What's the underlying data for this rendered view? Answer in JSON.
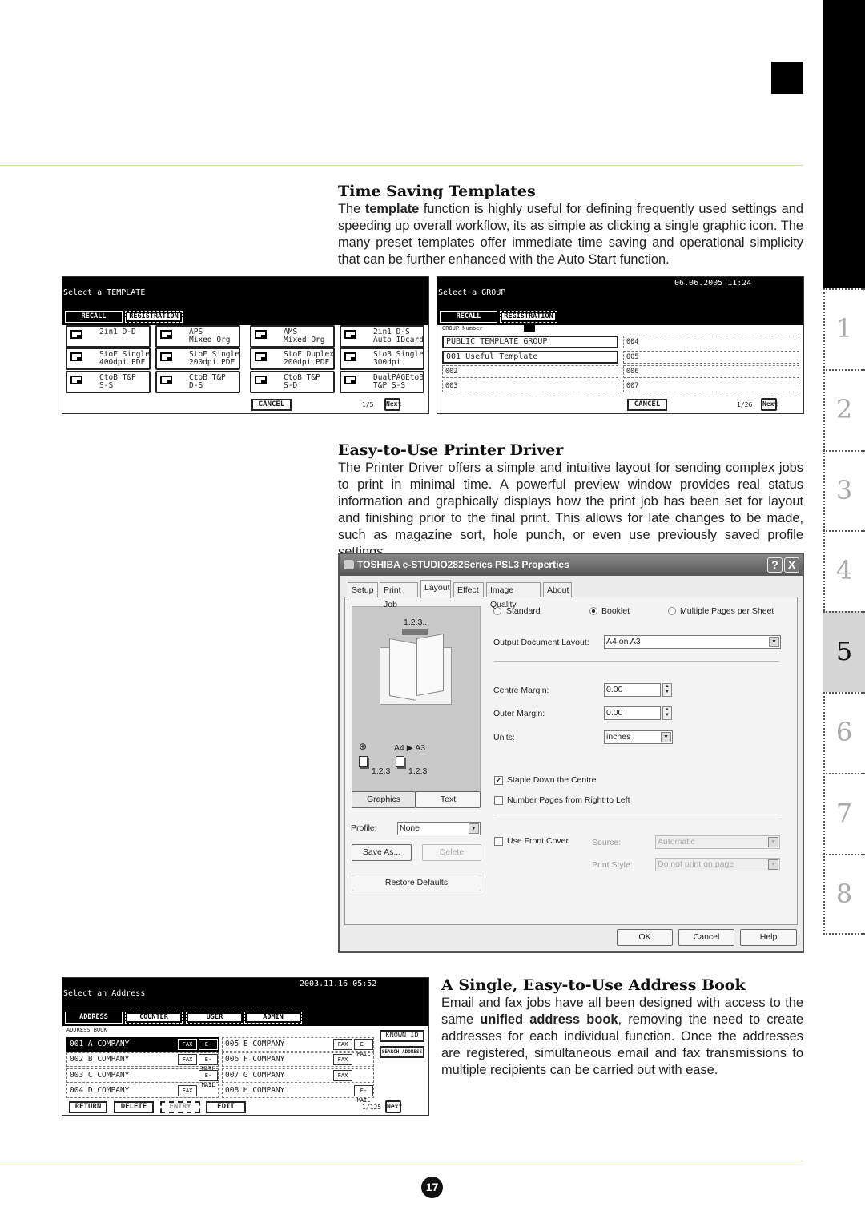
{
  "sidebar": {
    "tabs": [
      "1",
      "2",
      "3",
      "4",
      "5",
      "6",
      "7",
      "8"
    ],
    "active": "5"
  },
  "sections": {
    "templates": {
      "heading": "Time Saving Templates",
      "body_pre": "The ",
      "body_bold": "template",
      "body_post": " function is highly useful for defining frequently used settings and speeding up overall workflow, its as simple as clicking a single graphic icon. The many preset templates offer immediate time saving and operational simplicity that can be further enhanced with the Auto Start function."
    },
    "printer": {
      "heading": "Easy-to-Use Printer Driver",
      "body": "The Printer Driver offers a simple and intuitive layout for sending complex jobs to print in minimal time. A powerful preview window provides real status information and graphically displays how the print job has been set for layout and finishing prior to the final print. This allows for late changes to be made, such as magazine sort, hole punch, or even use previously saved profile settings."
    },
    "address": {
      "heading": "A Single, Easy-to-Use Address Book",
      "body_pre": "Email and fax jobs have all been designed with access to the same ",
      "body_bold": "unified address book",
      "body_post": ", removing the need to create addresses for each individual function. Once the addresses are registered, simultaneous email and fax transmissions to multiple recipients can be carried out with ease."
    }
  },
  "template_panel": {
    "title": "Select a TEMPLATE",
    "tabs": [
      "RECALL",
      "REGISTRATION"
    ],
    "buttons": [
      "2in1 D-D",
      "APS\nMixed Org",
      "AMS\nMixed Org",
      "2in1 D-S\nAuto IDcard",
      "StoF Single\n400dpi PDF",
      "StoF Single\n200dpi PDF",
      "StoF Duplex\n200dpi PDF",
      "StoB Single\n300dpi",
      "CtoB T&P\nS-S",
      "CtoB T&P\nD-S",
      "CtoB T&P\nS-D",
      "DualPAGEtoB\nT&P S-S"
    ],
    "cancel": "CANCEL",
    "page": "1/5",
    "next": "Next"
  },
  "group_panel": {
    "title": "Select a GROUP",
    "datetime": "06.06.2005 11:24",
    "tabs": [
      "RECALL",
      "REGISTRATION"
    ],
    "group_number_label": "GROUP Number",
    "left": [
      "PUBLIC TEMPLATE GROUP",
      "001 Useful Template",
      "002",
      "003"
    ],
    "right": [
      "004",
      "005",
      "006",
      "007"
    ],
    "cancel": "CANCEL",
    "page": "1/26",
    "next": "Next"
  },
  "printer_dialog": {
    "title": "TOSHIBA e-STUDIO282Series PSL3 Properties",
    "help_btn": "?",
    "close_btn": "X",
    "tabs": [
      "Setup",
      "Print Job",
      "Layout",
      "Effect",
      "Image Quality",
      "About"
    ],
    "active_tab": "Layout",
    "preview": {
      "seq": "1.2.3...",
      "size_from": "A4",
      "size_to": "A3",
      "stack1": "1.2.3",
      "stack2": "1.2.3"
    },
    "view_buttons": [
      "Graphics",
      "Text"
    ],
    "profile_label": "Profile:",
    "profile_value": "None",
    "save_as": "Save As...",
    "delete": "Delete",
    "restore": "Restore Defaults",
    "layout_options": [
      "Standard",
      "Booklet",
      "Multiple Pages per Sheet"
    ],
    "selected_layout": "Booklet",
    "output_label": "Output Document Layout:",
    "output_value": "A4 on A3",
    "centre_label": "Centre Margin:",
    "centre_value": "0.00",
    "outer_label": "Outer Margin:",
    "outer_value": "0.00",
    "units_label": "Units:",
    "units_value": "inches",
    "staple_label": "Staple Down the Centre",
    "staple_checked": true,
    "rtl_label": "Number Pages from Right to Left",
    "rtl_checked": false,
    "front_cover_label": "Use Front Cover",
    "front_cover_checked": false,
    "source_label": "Source:",
    "source_value": "Automatic",
    "print_style_label": "Print Style:",
    "print_style_value": "Do not print on page",
    "ok": "OK",
    "cancel": "Cancel",
    "help": "Help"
  },
  "address_panel": {
    "title": "Select an Address",
    "datetime": "2003.11.16 05:52",
    "tabs": [
      "ADDRESS",
      "COUNTER",
      "USER",
      "ADMIN"
    ],
    "book_label": "ADDRESS BOOK",
    "entries": [
      {
        "name": "001 A COMPANY",
        "fax": "FAX",
        "email": "E-MAIL",
        "selected": true
      },
      {
        "name": "002 B COMPANY",
        "fax": "FAX",
        "email": "E-MAIL"
      },
      {
        "name": "003 C COMPANY",
        "fax": "",
        "email": "E-MAIL"
      },
      {
        "name": "004 D COMPANY",
        "fax": "FAX",
        "email": ""
      },
      {
        "name": "005 E COMPANY",
        "fax": "FAX",
        "email": "E-MAIL"
      },
      {
        "name": "006 F COMPANY",
        "fax": "FAX",
        "email": ""
      },
      {
        "name": "007 G COMPANY",
        "fax": "FAX",
        "email": ""
      },
      {
        "name": "008 H COMPANY",
        "fax": "",
        "email": "E-MAIL"
      }
    ],
    "known_id": "KNOWN ID",
    "search": "SEARCH ADDRESS",
    "bottom": [
      "RETURN",
      "DELETE",
      "ENTRY",
      "EDIT"
    ],
    "page": "1/125",
    "next": "Next"
  },
  "page_number": "17",
  "colors": {
    "rule": "#c5e59a",
    "active_tab": "#d6d6d6"
  }
}
